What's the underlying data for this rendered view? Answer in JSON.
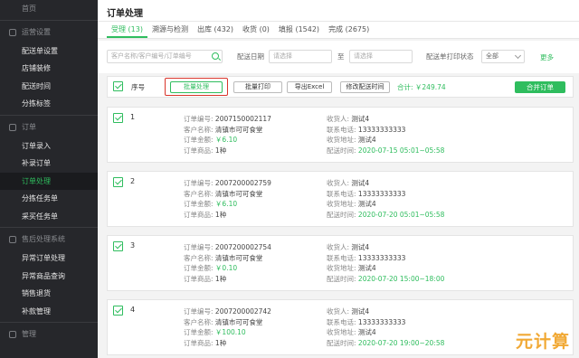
{
  "sidebar": {
    "top_item": "首页",
    "sections": [
      {
        "title": "运营设置",
        "items": [
          "配送单设置",
          "店铺装修",
          "配送时间",
          "分拣标签"
        ]
      },
      {
        "title": "订单",
        "items": [
          "订单录入",
          "补录订单",
          "订单处理",
          "分拣任务单",
          "采买任务单"
        ],
        "active": "订单处理"
      },
      {
        "title": "售后处理系统",
        "items": [
          "异常订单处理",
          "异常商品查询",
          "销售退货",
          "补款管理"
        ]
      },
      {
        "title": "管理",
        "items": []
      }
    ]
  },
  "header": {
    "title": "订单处理"
  },
  "tabs": [
    {
      "label": "受理 (13)",
      "active": true
    },
    {
      "label": "溯源与检测",
      "active": false
    },
    {
      "label": "出库 (432)",
      "active": false
    },
    {
      "label": "收货 (0)",
      "active": false
    },
    {
      "label": "填报 (1542)",
      "active": false
    },
    {
      "label": "完成 (2675)",
      "active": false
    }
  ],
  "filters": {
    "search_placeholder": "客户名称/客户编号/订单编号",
    "date_label": "配送日期",
    "date_from_placeholder": "请选择",
    "date_sep": "至",
    "date_to_placeholder": "请选择",
    "print_status_label": "配送单打印状态",
    "print_status_value": "全部",
    "more_label": "更多"
  },
  "toolbar": {
    "seq_label": "序号",
    "batch_process": "批量处理",
    "batch_print": "批量打印",
    "export_excel": "导出Excel",
    "modify_time": "修改配送时间",
    "total": "合计: ￥249.74",
    "merge": "合并订单"
  },
  "labels": {
    "order_no": "订单编号:",
    "customer": "客户名称:",
    "amount": "订单金额:",
    "goods": "订单商品:",
    "receiver": "收货人:",
    "phone": "联系电话:",
    "address": "收货地址:",
    "delivery_time": "配送时间:"
  },
  "orders": [
    {
      "num": "1",
      "order_no": "2007150002117",
      "customer": "清镇市可可食堂",
      "amount": "￥6.10",
      "goods": "1种",
      "receiver": "测试4",
      "phone": "13333333333",
      "address": "测试4",
      "delivery_time": "2020-07-15 05:01~05:58"
    },
    {
      "num": "2",
      "order_no": "2007200002759",
      "customer": "清镇市可可食堂",
      "amount": "￥6.10",
      "goods": "1种",
      "receiver": "测试4",
      "phone": "13333333333",
      "address": "测试4",
      "delivery_time": "2020-07-20 05:01~05:58"
    },
    {
      "num": "3",
      "order_no": "2007200002754",
      "customer": "清镇市可可食堂",
      "amount": "￥0.10",
      "goods": "1种",
      "receiver": "测试4",
      "phone": "13333333333",
      "address": "测试4",
      "delivery_time": "2020-07-20 15:00~18:00"
    },
    {
      "num": "4",
      "order_no": "2007200002742",
      "customer": "清镇市可可食堂",
      "amount": "￥100.10",
      "goods": "1种",
      "receiver": "测试4",
      "phone": "13333333333",
      "address": "测试4",
      "delivery_time": "2020-07-20 19:00~20:58"
    }
  ],
  "watermark": "元计算",
  "colors": {
    "accent": "#2fbd5e",
    "sidebar_bg": "#26272b",
    "highlight": "#d9342b"
  }
}
